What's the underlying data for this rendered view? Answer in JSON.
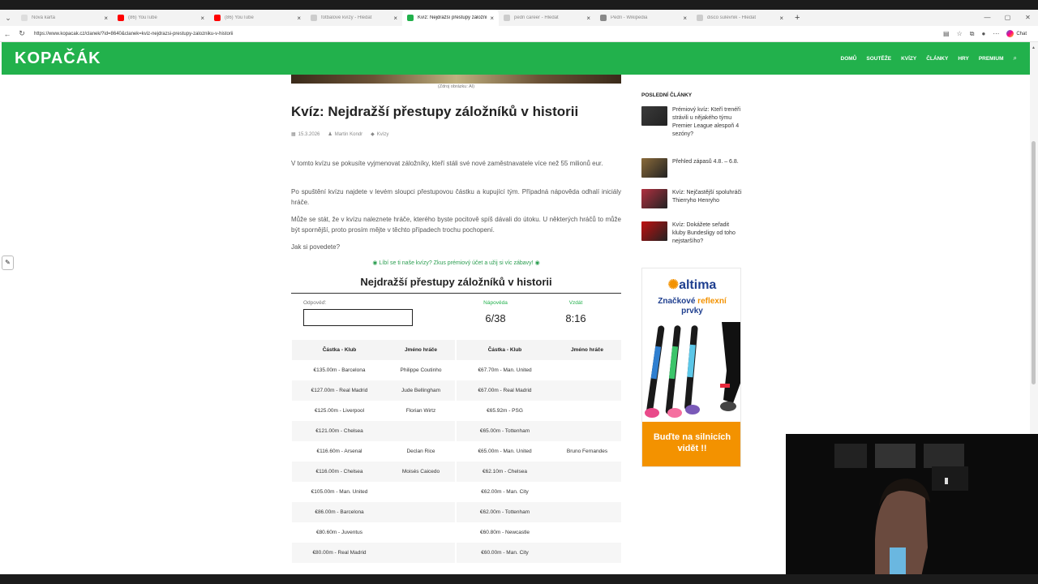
{
  "browser": {
    "tabs": [
      {
        "title": "Nová karta",
        "color": "#dddddd",
        "active": false
      },
      {
        "title": "(86) YouTube",
        "color": "#ff0000",
        "active": false
      },
      {
        "title": "(86) YouTube",
        "color": "#ff0000",
        "active": false
      },
      {
        "title": "fotbalové kvízy - Hledat",
        "color": "#cccccc",
        "active": false
      },
      {
        "title": "Kvíz: Nejdražší přestupy záložníků",
        "color": "#22b14c",
        "active": true
      },
      {
        "title": "pedri career - Hledat",
        "color": "#cccccc",
        "active": false
      },
      {
        "title": "Pedri - Wikipedia",
        "color": "#888888",
        "active": false
      },
      {
        "title": "disco sulevnik - Hledat",
        "color": "#cccccc",
        "active": false
      }
    ],
    "url": "https://www.kopacak.cz/clanek/?id=8640&clanek=kviz-nejdrazsi-prestupy-zalozniku-v-historii",
    "chat_label": "Chat"
  },
  "site": {
    "logo": "KOPAČÁK",
    "menu": [
      "DOMŮ",
      "SOUTĚŽE",
      "KVÍZY",
      "ČLÁNKY",
      "HRY",
      "PREMIUM"
    ]
  },
  "article": {
    "image_caption": "(Zdroj obrázku: AI)",
    "title": "Kvíz: Nejdražší přestupy záložníků v historii",
    "date": "15.3.2026",
    "author": "Martin Kondr",
    "category": "Kvízy",
    "paragraphs": [
      "V tomto kvízu se pokusíte vyjmenovat záložníky, kteří stáli své nové zaměstnavatele více než 55 milionů eur.",
      "Po spuštění kvízu najdete v levém sloupci přestupovou částku a kupující tým. Případná nápověda odhalí iniciály hráče.",
      "Může se stát, že v kvízu naleznete hráče, kterého byste pocitově spíš dávali do útoku. U některých hráčů to může být spornější, proto prosím mějte v těchto případech trochu pochopení.",
      "Jak si povedete?"
    ],
    "promo": "Líbí se ti naše kvízy? Zkus prémiový účet a užij si víc zábavy!"
  },
  "quiz": {
    "title": "Nejdražší přestupy záložníků v historii",
    "answer_label": "Odpověď:",
    "answer_value": "",
    "hint_label": "Nápověda",
    "giveup_label": "Vzdát",
    "count": "6/38",
    "timer": "8:16",
    "headers": [
      "Částka - Klub",
      "Jméno hráče",
      "Částka - Klub",
      "Jméno hráče"
    ],
    "rows": [
      [
        "€135.00m - Barcelona",
        "Philippe Coutinho",
        "€67.70m - Man. United",
        ""
      ],
      [
        "€127.00m - Real Madrid",
        "Jude Bellingham",
        "€67.00m - Real Madrid",
        ""
      ],
      [
        "€125.00m - Liverpool",
        "Florian Wirtz",
        "€65.92m - PSG",
        ""
      ],
      [
        "€121.00m - Chelsea",
        "",
        "€65.00m - Tottenham",
        ""
      ],
      [
        "€116.60m - Arsenal",
        "Declan Rice",
        "€65.00m - Man. United",
        "Bruno Fernandes"
      ],
      [
        "€116.00m - Chelsea",
        "Moisés Caicedo",
        "€62.10m - Chelsea",
        ""
      ],
      [
        "€105.00m - Man. United",
        "",
        "€62.00m - Man. City",
        ""
      ],
      [
        "€86.00m - Barcelona",
        "",
        "€62.00m - Tottenham",
        ""
      ],
      [
        "€80.60m - Juventus",
        "",
        "€60.80m - Newcastle",
        ""
      ],
      [
        "€80.00m - Real Madrid",
        "",
        "€60.00m - Man. City",
        ""
      ]
    ]
  },
  "sidebar": {
    "heading": "POSLEDNÍ ČLÁNKY",
    "posts": [
      {
        "title": "Prémiový kvíz: Kteří trenéři strávili u nějakého týmu Premier League alespoň 4 sezóny?",
        "color": "#3a3a3a"
      },
      {
        "title": "Přehled zápasů 4.8. – 6.8.",
        "color": "#8a6a3a"
      },
      {
        "title": "Kvíz: Nejčastější spoluhráči Thierryho Henryho",
        "color": "#b03040"
      },
      {
        "title": "Kvíz: Dokážete seřadit kluby Bundesligy od toho nejstaršího?",
        "color": "#c01010"
      }
    ]
  },
  "ad": {
    "brand": "altima",
    "tag_line1": "Značkové",
    "tag_highlight": "reflexní",
    "tag_line2": "prvky",
    "cta": "Buďte na silnicích vidět !!"
  }
}
